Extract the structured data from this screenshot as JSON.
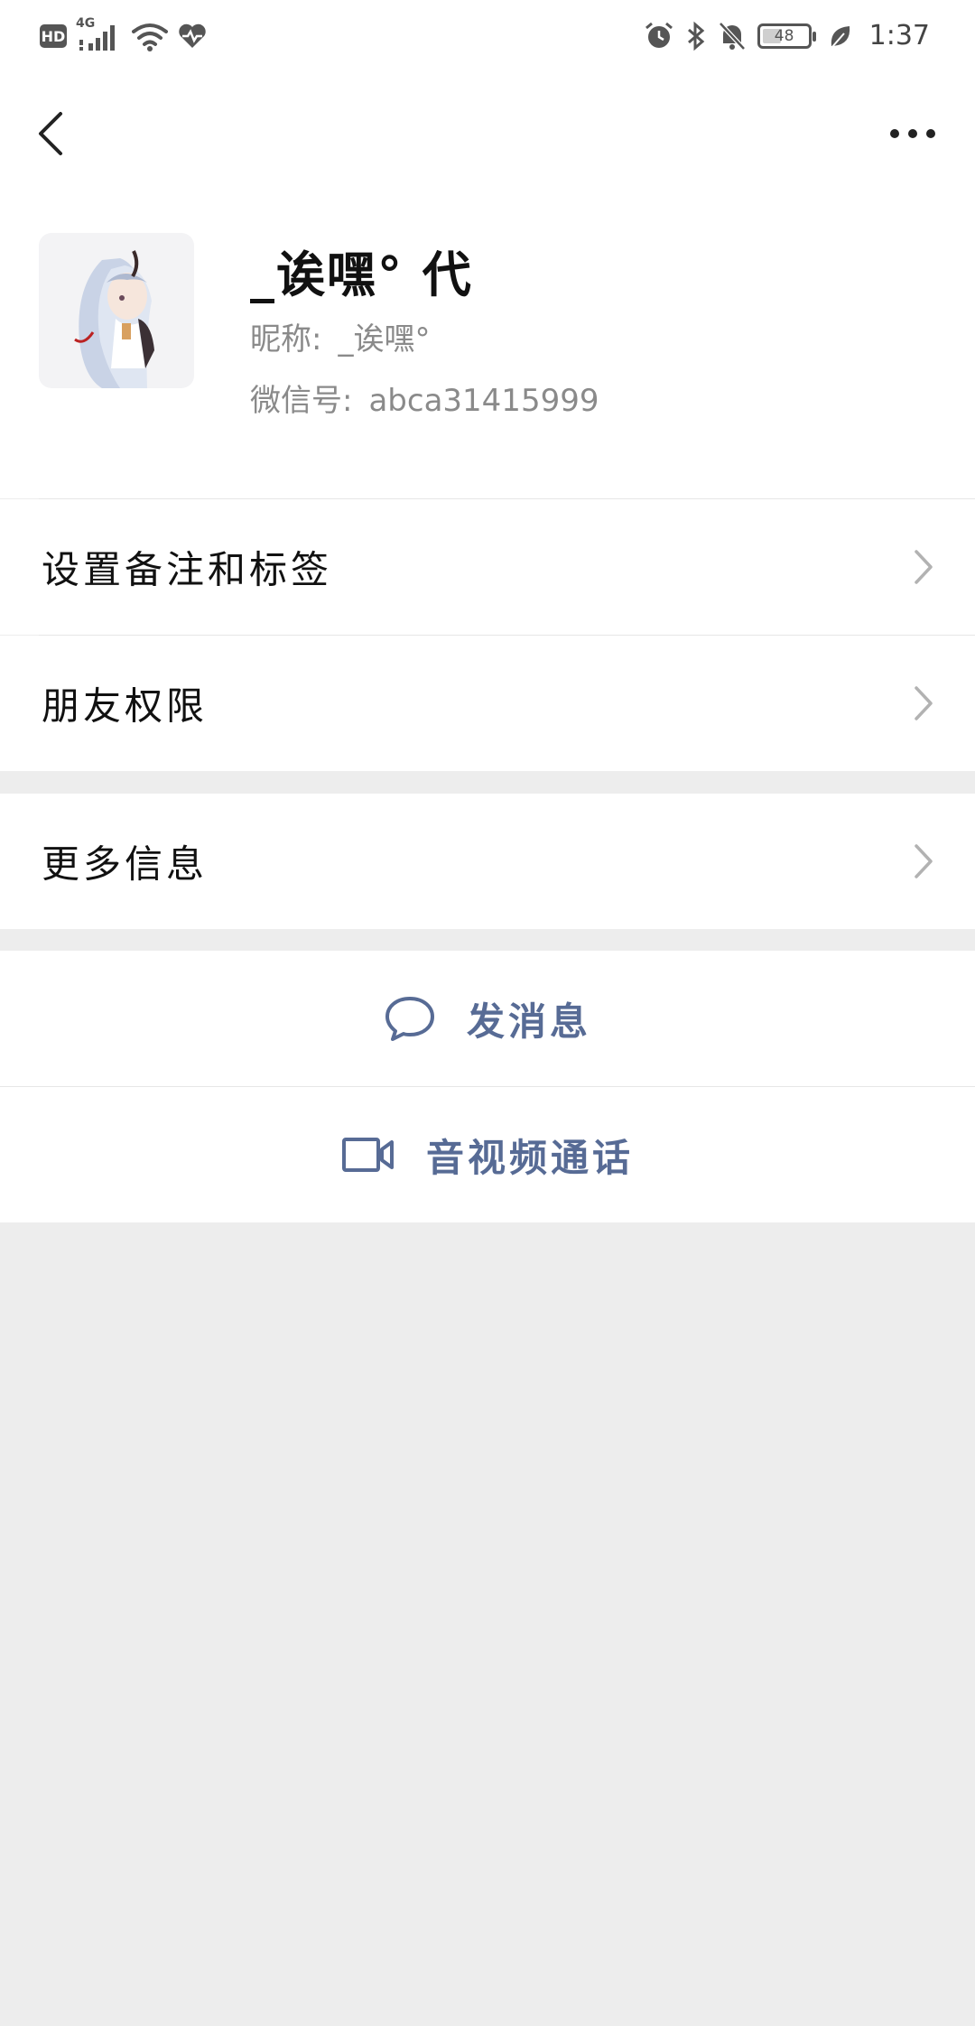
{
  "status_bar": {
    "left_icons": [
      "hd-icon",
      "signal-4g-icon",
      "wifi-icon",
      "health-heart-icon"
    ],
    "hd_label": "HD",
    "network_label": "4G",
    "right_icons": [
      "alarm-icon",
      "bluetooth-icon",
      "mute-bell-icon",
      "battery-icon",
      "leaf-icon"
    ],
    "battery_level": "48",
    "time": "1:37"
  },
  "nav": {
    "back_icon": "chevron-left-icon",
    "more_icon": "more-dots-icon"
  },
  "profile": {
    "display_name": "_诶嘿° 代",
    "nickname_label": "昵称:",
    "nickname_value": "_诶嘿°",
    "wechat_id_label": "微信号:",
    "wechat_id_value": "abca31415999"
  },
  "menu": {
    "set_remark": "设置备注和标签",
    "friend_permission": "朋友权限",
    "more_info": "更多信息"
  },
  "actions": {
    "send_message": "发消息",
    "video_call": "音视频通话"
  },
  "colors": {
    "link_blue": "#576b95",
    "background": "#ededed",
    "panel": "#ffffff"
  }
}
